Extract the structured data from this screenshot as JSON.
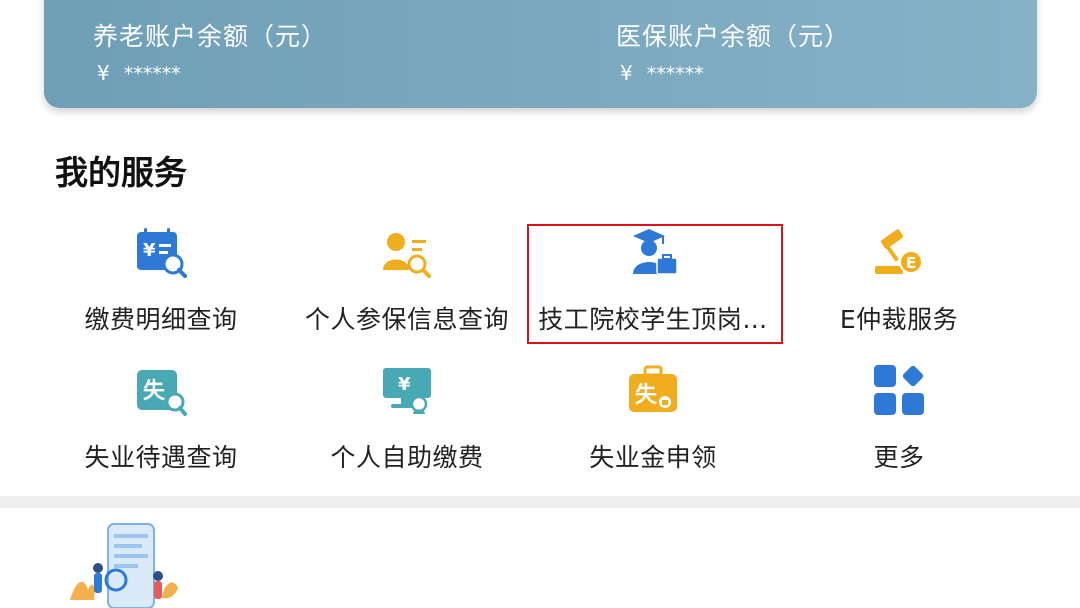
{
  "accounts": {
    "pension": {
      "label": "养老账户余额（元）",
      "currency": "¥",
      "masked": "******"
    },
    "medical": {
      "label": "医保账户余额（元）",
      "currency": "¥",
      "masked": "******"
    }
  },
  "section": {
    "title": "我的服务"
  },
  "services": [
    {
      "label": "缴费明细查询",
      "icon": "payment-detail-query-icon"
    },
    {
      "label": "个人参保信息查询",
      "icon": "insurance-info-query-icon"
    },
    {
      "label": "技工院校学生顶岗…",
      "icon": "student-internship-icon"
    },
    {
      "label": "E仲裁服务",
      "icon": "e-arbitration-icon"
    },
    {
      "label": "失业待遇查询",
      "icon": "unemployment-benefit-query-icon"
    },
    {
      "label": "个人自助缴费",
      "icon": "self-service-payment-icon"
    },
    {
      "label": "失业金申领",
      "icon": "unemployment-claim-icon"
    },
    {
      "label": "更多",
      "icon": "more-grid-icon"
    }
  ],
  "colors": {
    "blue": "#2e78d6",
    "gold": "#f0ae1f",
    "teal": "#48a9b5",
    "highlight": "#d8131b"
  }
}
